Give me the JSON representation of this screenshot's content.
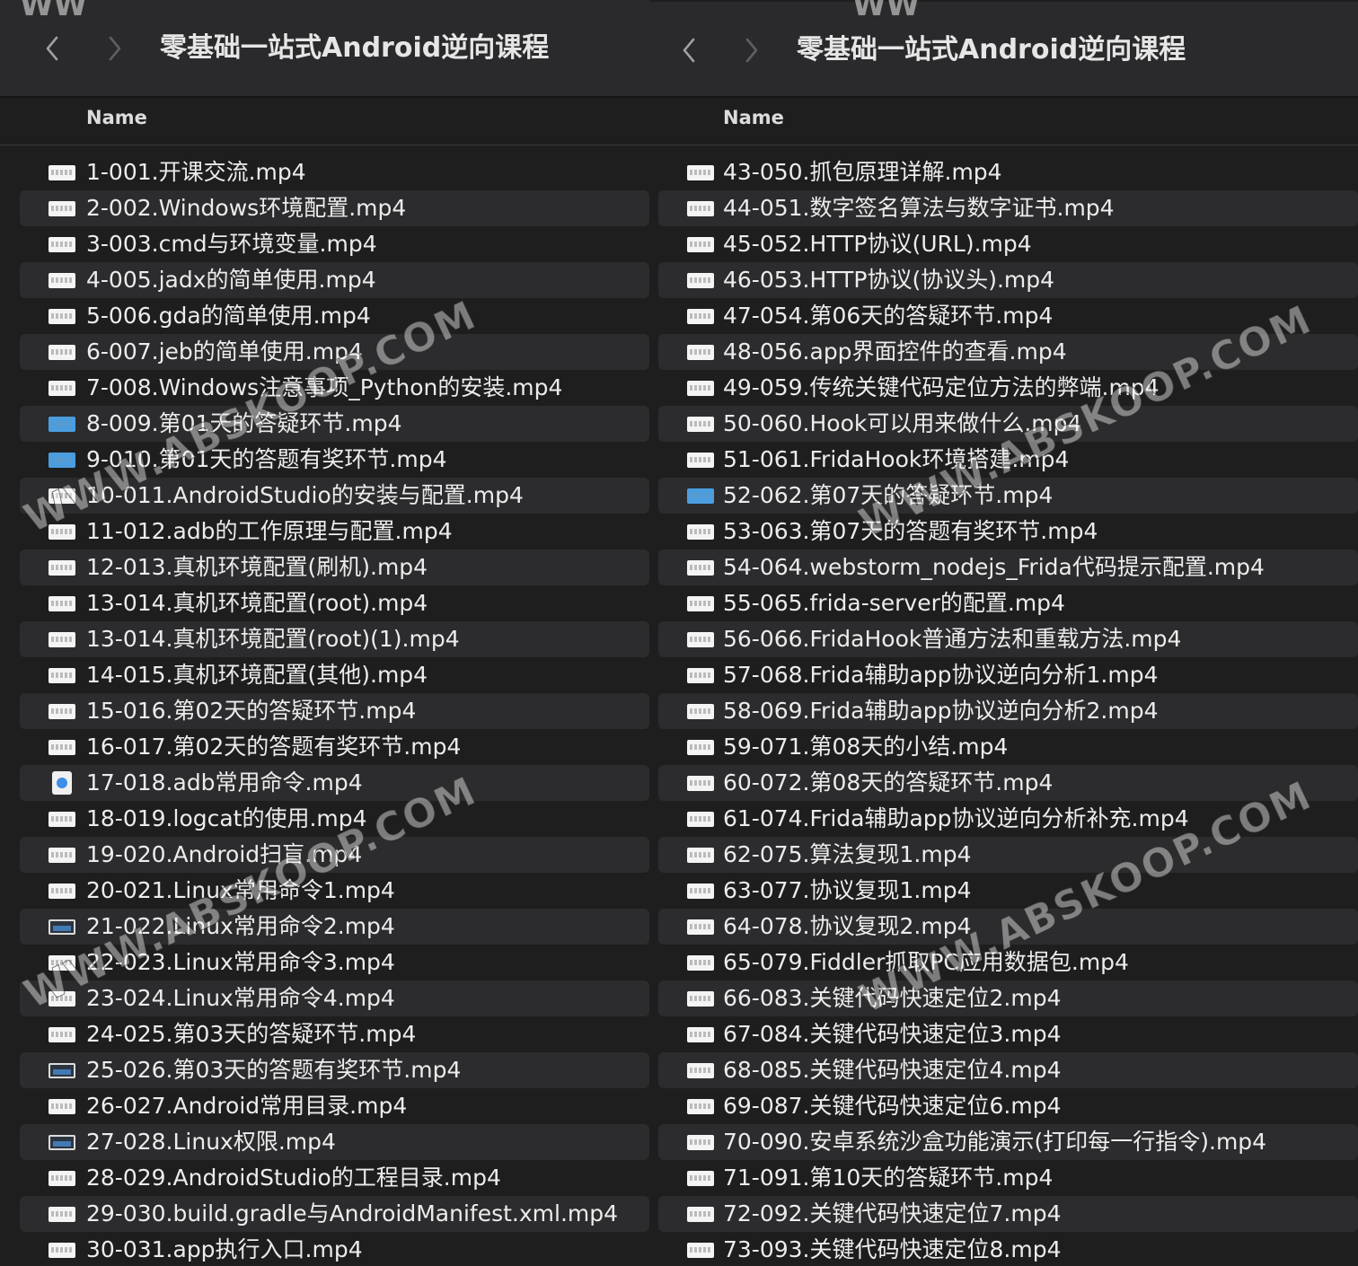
{
  "left_window": {
    "title": "零基础一站式Android逆向课程",
    "column_header": "Name",
    "files": [
      "1-001.开课交流.mp4",
      "2-002.Windows环境配置.mp4",
      "3-003.cmd与环境变量.mp4",
      "4-005.jadx的简单使用.mp4",
      "5-006.gda的简单使用.mp4",
      "6-007.jeb的简单使用.mp4",
      "7-008.Windows注意事项_Python的安装.mp4",
      "8-009.第01天的答疑环节.mp4",
      "9-010.第01天的答题有奖环节.mp4",
      "10-011.AndroidStudio的安装与配置.mp4",
      "11-012.adb的工作原理与配置.mp4",
      "12-013.真机环境配置(刷机).mp4",
      "13-014.真机环境配置(root).mp4",
      "13-014.真机环境配置(root)(1).mp4",
      "14-015.真机环境配置(其他).mp4",
      "15-016.第02天的答疑环节.mp4",
      "16-017.第02天的答题有奖环节.mp4",
      "17-018.adb常用命令.mp4",
      "18-019.logcat的使用.mp4",
      "19-020.Android扫盲.mp4",
      "20-021.Linux常用命令1.mp4",
      "21-022.Linux常用命令2.mp4",
      "22-023.Linux常用命令3.mp4",
      "23-024.Linux常用命令4.mp4",
      "24-025.第03天的答疑环节.mp4",
      "25-026.第03天的答题有奖环节.mp4",
      "26-027.Android常用目录.mp4",
      "27-028.Linux权限.mp4",
      "28-029.AndroidStudio的工程目录.mp4",
      "29-030.build.gradle与AndroidManifest.xml.mp4",
      "30-031.app执行入口.mp4"
    ],
    "icon_types": [
      "video",
      "video",
      "video",
      "video",
      "video",
      "video",
      "video",
      "blue",
      "blue",
      "video",
      "video",
      "video",
      "video",
      "video",
      "video",
      "video",
      "video",
      "doc",
      "video",
      "video",
      "video",
      "dark",
      "video",
      "video",
      "video",
      "dark",
      "video",
      "dark",
      "video",
      "video",
      "video"
    ]
  },
  "right_window": {
    "title": "零基础一站式Android逆向课程",
    "column_header": "Name",
    "files": [
      "43-050.抓包原理详解.mp4",
      "44-051.数字签名算法与数字证书.mp4",
      "45-052.HTTP协议(URL).mp4",
      "46-053.HTTP协议(协议头).mp4",
      "47-054.第06天的答疑环节.mp4",
      "48-056.app界面控件的查看.mp4",
      "49-059.传统关键代码定位方法的弊端.mp4",
      "50-060.Hook可以用来做什么.mp4",
      "51-061.FridaHook环境搭建.mp4",
      "52-062.第07天的答疑环节.mp4",
      "53-063.第07天的答题有奖环节.mp4",
      "54-064.webstorm_nodejs_Frida代码提示配置.mp4",
      "55-065.frida-server的配置.mp4",
      "56-066.FridaHook普通方法和重载方法.mp4",
      "57-068.Frida辅助app协议逆向分析1.mp4",
      "58-069.Frida辅助app协议逆向分析2.mp4",
      "59-071.第08天的小结.mp4",
      "60-072.第08天的答疑环节.mp4",
      "61-074.Frida辅助app协议逆向分析补充.mp4",
      "62-075.算法复现1.mp4",
      "63-077.协议复现1.mp4",
      "64-078.协议复现2.mp4",
      "65-079.Fiddler抓取PC应用数据包.mp4",
      "66-083.关键代码快速定位2.mp4",
      "67-084.关键代码快速定位3.mp4",
      "68-085.关键代码快速定位4.mp4",
      "69-087.关键代码快速定位6.mp4",
      "70-090.安卓系统沙盒功能演示(打印每一行指令).mp4",
      "71-091.第10天的答疑环节.mp4",
      "72-092.关键代码快速定位7.mp4",
      "73-093.关键代码快速定位8.mp4"
    ],
    "icon_types": [
      "video",
      "video",
      "video",
      "video",
      "video",
      "video",
      "video",
      "video",
      "video",
      "blue",
      "video",
      "video",
      "video",
      "video",
      "video",
      "video",
      "video",
      "video",
      "video",
      "video",
      "video",
      "video",
      "video",
      "video",
      "video",
      "video",
      "video",
      "video",
      "video",
      "video",
      "video"
    ]
  },
  "watermarks": {
    "text": "WWW.ABSKOOP.COM",
    "top_fragment": "WW"
  }
}
